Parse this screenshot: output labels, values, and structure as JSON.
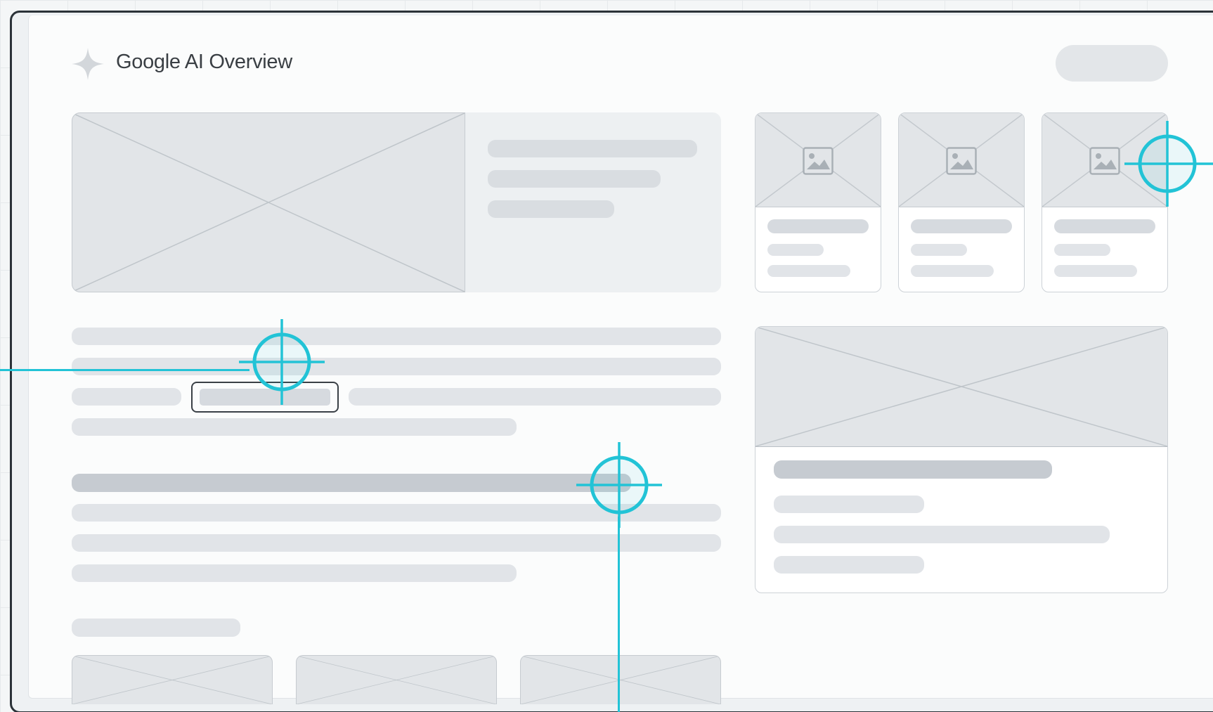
{
  "header": {
    "title": "Google AI Overview",
    "logo_icon": "sparkle-icon",
    "action_pill": "empty-pill-button"
  },
  "colors": {
    "accent": "#22c3d6",
    "frame": "#2b3238",
    "placeholder": "#e2e5e8",
    "skeleton": "#e1e4e8"
  },
  "hero": {
    "icon": "image-placeholder-icon"
  },
  "thumb_cards": [
    {
      "icon": "image-icon"
    },
    {
      "icon": "image-icon"
    },
    {
      "icon": "image-icon"
    }
  ],
  "side_card": {
    "icon": "image-placeholder-icon"
  },
  "targets": [
    {
      "icon": "crosshair-icon"
    },
    {
      "icon": "crosshair-icon"
    },
    {
      "icon": "crosshair-icon"
    }
  ]
}
